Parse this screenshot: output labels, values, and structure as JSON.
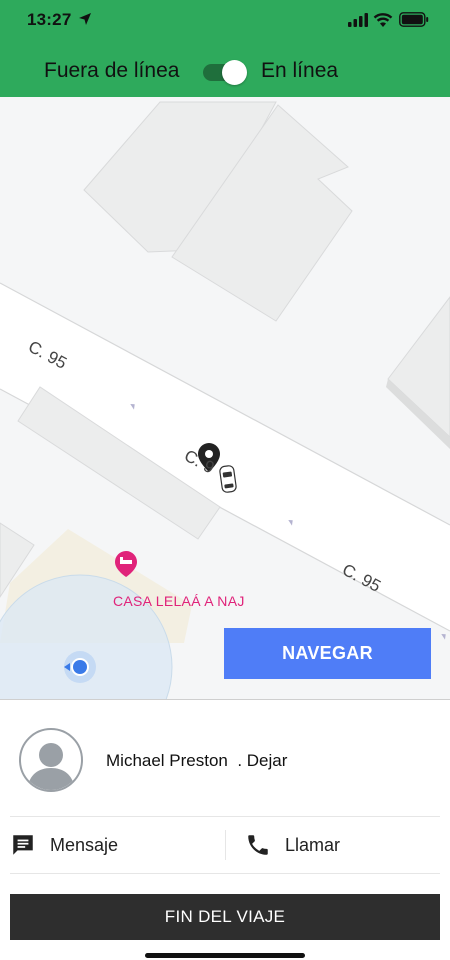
{
  "status_bar": {
    "time": "13:27"
  },
  "header": {
    "offline_label": "Fuera de línea",
    "online_label": "En línea",
    "toggle_on": true
  },
  "map": {
    "street_labels": [
      "C. 95",
      "C. 95",
      "C. 9"
    ],
    "poi_label": "CASA LELAÁ A NAJ",
    "navigate_button": "NAVEGAR"
  },
  "panel": {
    "rider_text": "Michael Preston  . Dejar",
    "message_label": "Mensaje",
    "call_label": "Llamar",
    "end_trip_button": "FIN DEL VIAJE"
  },
  "colors": {
    "header_green": "#2eaa5c",
    "navigate_blue": "#4f7df7",
    "poi_pink": "#e0237a",
    "end_button": "#2e2e2e"
  }
}
